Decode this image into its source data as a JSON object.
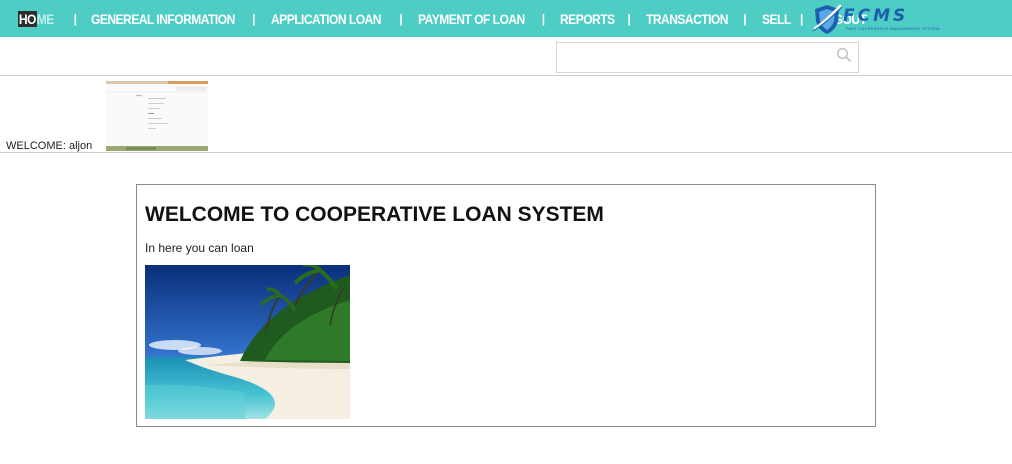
{
  "nav": {
    "home_a": "HO",
    "home_b": "ME",
    "items": [
      "GENEREAL INFORMATION",
      "APPLICATION LOAN",
      "PAYMENT OF LOAN",
      "REPORTS",
      "TRANSACTION",
      "SELL",
      "LOGOUT"
    ],
    "separator": "|"
  },
  "logo": {
    "title": "FCMS",
    "subtitle": "FAST COOPERATIVE MANAGEMENT SYSTEM"
  },
  "search": {
    "value": "",
    "placeholder": ""
  },
  "welcome": {
    "label": "WELCOME: aljon"
  },
  "main": {
    "title": "WELCOME TO COOPERATIVE LOAN SYSTEM",
    "text": "In here you can loan"
  },
  "colors": {
    "navbar": "#4ecdc4",
    "logo_blue": "#1b5fae",
    "card_border": "#8a8a8a"
  }
}
